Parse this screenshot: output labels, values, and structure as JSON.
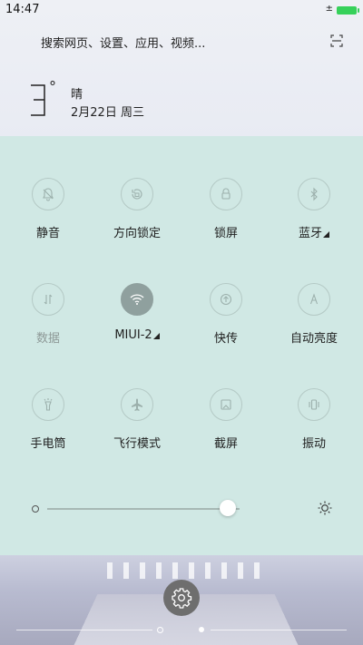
{
  "status_bar": {
    "time": "14:47",
    "charge_symbol": "±",
    "battery_color": "#36d15a"
  },
  "search": {
    "placeholder": "搜索网页、设置、应用、视频..."
  },
  "weather": {
    "temperature": "3",
    "degree": "°",
    "condition": "晴",
    "date": "2月22日 周三"
  },
  "quick_settings": {
    "background": "#d0e8e4",
    "tiles": [
      {
        "label": "静音",
        "icon": "bell-off-icon",
        "active": false,
        "dim": false
      },
      {
        "label": "方向锁定",
        "icon": "rotation-lock-icon",
        "active": false,
        "dim": false
      },
      {
        "label": "锁屏",
        "icon": "lock-icon",
        "active": false,
        "dim": false
      },
      {
        "label": "蓝牙",
        "icon": "bluetooth-icon",
        "active": false,
        "dim": false,
        "expandable": true
      },
      {
        "label": "数据",
        "icon": "mobile-data-icon",
        "active": false,
        "dim": true
      },
      {
        "label": "MIUI-2",
        "icon": "wifi-icon",
        "active": true,
        "dim": false,
        "expandable": true
      },
      {
        "label": "快传",
        "icon": "quick-transfer-icon",
        "active": false,
        "dim": false
      },
      {
        "label": "自动亮度",
        "icon": "auto-brightness-icon",
        "active": false,
        "dim": false
      },
      {
        "label": "手电筒",
        "icon": "flashlight-icon",
        "active": false,
        "dim": false
      },
      {
        "label": "飞行模式",
        "icon": "airplane-icon",
        "active": false,
        "dim": false
      },
      {
        "label": "截屏",
        "icon": "screenshot-icon",
        "active": false,
        "dim": false
      },
      {
        "label": "振动",
        "icon": "vibrate-icon",
        "active": false,
        "dim": false
      }
    ],
    "brightness_level": 0.94
  },
  "settings_button": {
    "icon": "gear-icon"
  },
  "pager": {
    "pages": 2,
    "current": 2
  }
}
